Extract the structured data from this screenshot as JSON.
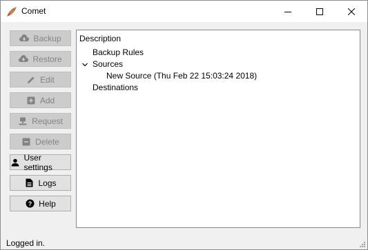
{
  "window": {
    "title": "Comet",
    "icon": "comet-app-icon"
  },
  "titlebar_buttons": {
    "minimize": "minimize-icon",
    "maximize": "maximize-icon",
    "close": "close-icon"
  },
  "sidebar": {
    "buttons": [
      {
        "label": "Backup",
        "icon": "cloud-upload-icon",
        "enabled": false
      },
      {
        "label": "Restore",
        "icon": "cloud-download-icon",
        "enabled": false
      },
      {
        "label": "Edit",
        "icon": "pencil-icon",
        "enabled": false
      },
      {
        "label": "Add",
        "icon": "plus-square-icon",
        "enabled": false
      },
      {
        "label": "Request",
        "icon": "network-icon",
        "enabled": false
      },
      {
        "label": "Delete",
        "icon": "minus-square-icon",
        "enabled": false
      },
      {
        "label": "User settings",
        "icon": "user-icon",
        "enabled": true
      },
      {
        "label": "Logs",
        "icon": "document-icon",
        "enabled": true
      },
      {
        "label": "Help",
        "icon": "question-circle-icon",
        "enabled": true
      }
    ]
  },
  "tree": {
    "header": "Description",
    "items": [
      {
        "label": "Backup Rules"
      },
      {
        "label": "Sources",
        "expanded": true
      },
      {
        "label": "New Source (Thu Feb 22 15:03:24 2018)"
      },
      {
        "label": "Destinations"
      }
    ]
  },
  "status_bar": {
    "text": "Logged in."
  },
  "colors": {
    "disabled_button_bg": "#cccccc",
    "enabled_button_bg": "#e1e1e1",
    "disabled_text": "#838383"
  }
}
